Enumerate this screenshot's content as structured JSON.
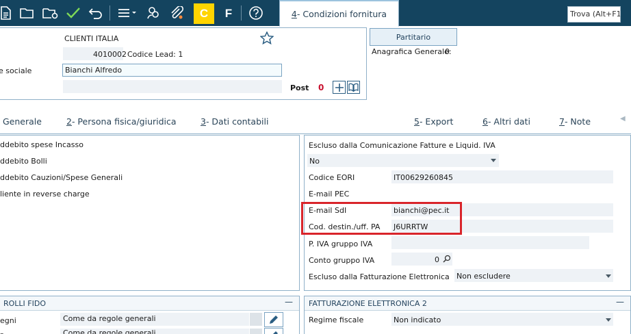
{
  "toolbar": {
    "icons": [
      "document-icon",
      "folder-open-icon",
      "folder-gear-icon",
      "check-icon",
      "undo-icon",
      "menu-icon",
      "users-icon",
      "attachment-icon",
      "c-mode-icon",
      "f-mode-icon",
      "help-icon"
    ],
    "c_label": "C",
    "f_label": "F",
    "search_placeholder": "Trova (Alt+F1)"
  },
  "header": {
    "category": "CLIENTI ITALIA",
    "code": "4010002",
    "lead_label": "Codice Lead: 1",
    "ragione_label": "e sociale",
    "ragione_value": "Bianchi Alfredo",
    "post_label": "Post",
    "post_count": "0",
    "partitario_label": "Partitario",
    "anagrafica_label": "Anagrafica Generale:",
    "anagrafica_value": "0"
  },
  "tabs": [
    {
      "num": "",
      "label": "Generale"
    },
    {
      "num": "2",
      "label": " - Persona fisica/giuridica"
    },
    {
      "num": "3",
      "label": " - Dati contabili"
    },
    {
      "num": "4",
      "label": " - Condizioni fornitura"
    },
    {
      "num": "5",
      "label": " - Export"
    },
    {
      "num": "6",
      "label": " - Altri dati"
    },
    {
      "num": "7",
      "label": " - Note"
    }
  ],
  "left_panel": {
    "items": [
      "ddebito spese Incasso",
      "ddebito Bolli",
      "ddebito Cauzioni/Spese Generali",
      "liente in reverse charge"
    ]
  },
  "right_panel": {
    "escluso_comunicazione_label": "Escluso dalla Comunicazione Fatture e Liquid. IVA",
    "escluso_comunicazione_value": "No",
    "eori_label": "Codice EORI",
    "eori_value": "IT00629260845",
    "pec_label": "E-mail PEC",
    "sdi_label": "E-mail SdI",
    "sdi_value": "bianchi@pec.it",
    "cod_dest_label": "Cod. destin./uff. PA",
    "cod_dest_value": "J6URRTW",
    "piva_gruppo_label": "P. IVA gruppo IVA",
    "conto_gruppo_label": "Conto gruppo IVA",
    "conto_gruppo_value": "0",
    "escluso_fatt_label": "Escluso dalla Fatturazione Elettronica",
    "escluso_fatt_value": "Non escludere"
  },
  "fido_panel": {
    "title": "ROLLI FIDO",
    "row1_label": "egni",
    "row1_value": "Come da regole generali",
    "row2_label": "r",
    "row2_value": "Come da regole generali"
  },
  "fatt_panel": {
    "title": "FATTURAZIONE ELETTRONICA 2",
    "regime_label": "Regime fiscale",
    "regime_value": "Non indicato"
  },
  "colors": {
    "toolbar_bg": "#14445f",
    "accent_yellow": "#ffd400",
    "highlight_red": "#d9242a",
    "post_count_red": "#c8102e"
  }
}
